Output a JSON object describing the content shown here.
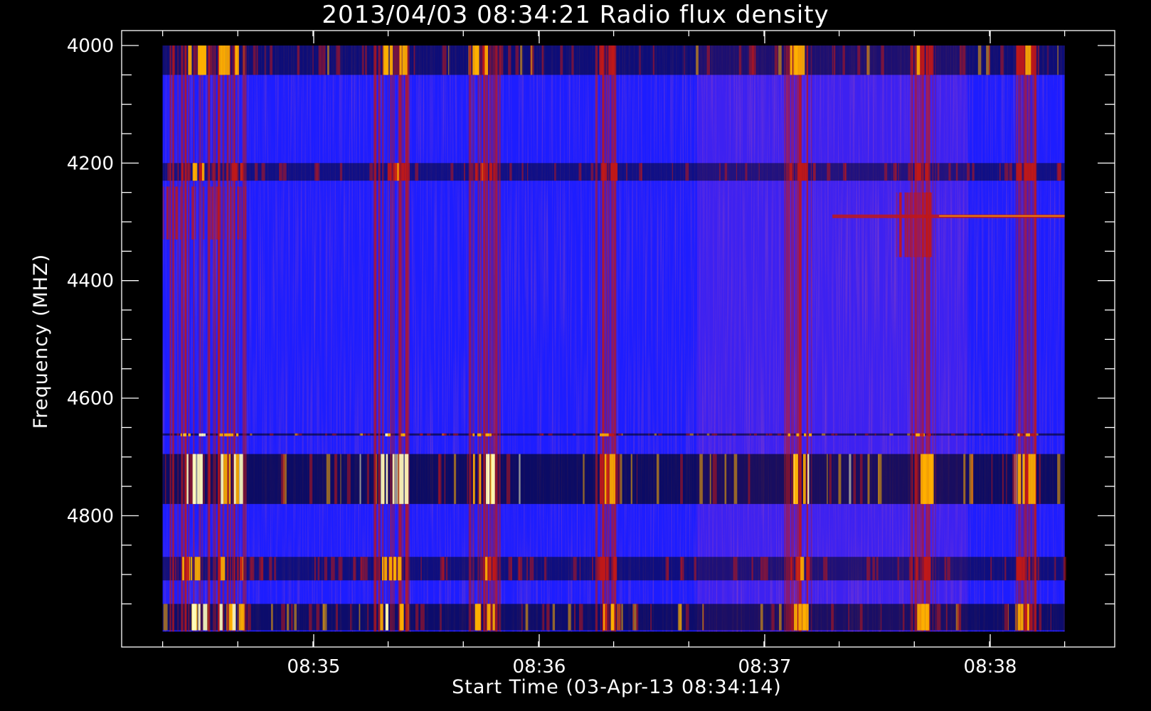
{
  "chart_data": {
    "type": "heatmap",
    "title": "2013/04/03 08:34:21 Radio flux density",
    "xlabel": "Start Time (03-Apr-13 08:34:14)",
    "ylabel": "Frequency (MHZ)",
    "x_ticks": [
      {
        "label": "08:35",
        "value": 35.0
      },
      {
        "label": "08:36",
        "value": 36.0
      },
      {
        "label": "08:37",
        "value": 37.0
      },
      {
        "label": "08:38",
        "value": 38.0
      }
    ],
    "y_ticks": [
      {
        "label": "4000",
        "value": 4000
      },
      {
        "label": "4200",
        "value": 4200
      },
      {
        "label": "4400",
        "value": 4400
      },
      {
        "label": "4600",
        "value": 4600
      },
      {
        "label": "4800",
        "value": 4800
      }
    ],
    "xlim": [
      34.33,
      38.73
    ],
    "ylim": [
      4000,
      5000
    ],
    "data_extent": {
      "x": [
        34.33,
        38.33
      ],
      "y": [
        4000,
        4997
      ]
    },
    "colormap": [
      "#000000",
      "#1d1dff",
      "#7a2bd8",
      "#c01818",
      "#ffb000",
      "#ffffc0"
    ],
    "grid": false,
    "horizontal_bands": [
      {
        "y_range": [
          4000,
          4050
        ],
        "intensity": 0.6
      },
      {
        "y_range": [
          4200,
          4230
        ],
        "intensity": 0.4
      },
      {
        "y_range": [
          4660,
          4660
        ],
        "intensity": 0.7
      },
      {
        "y_range": [
          4695,
          4780
        ],
        "intensity": 0.85
      },
      {
        "y_range": [
          4870,
          4910
        ],
        "intensity": 0.5
      },
      {
        "y_range": [
          4950,
          4995
        ],
        "intensity": 0.75
      }
    ],
    "bursts": [
      {
        "time": 34.45,
        "y_range": [
          4000,
          4995
        ],
        "intensity": 0.95
      },
      {
        "time": 34.63,
        "y_range": [
          4000,
          4995
        ],
        "intensity": 0.85
      },
      {
        "time": 35.35,
        "y_range": [
          4000,
          4995
        ],
        "intensity": 0.9
      },
      {
        "time": 35.75,
        "y_range": [
          4000,
          4995
        ],
        "intensity": 0.8
      },
      {
        "time": 36.3,
        "y_range": [
          4000,
          4995
        ],
        "intensity": 0.55
      },
      {
        "time": 37.15,
        "y_range": [
          4000,
          4995
        ],
        "intensity": 0.75
      },
      {
        "time": 37.7,
        "y_range": [
          4000,
          4995
        ],
        "intensity": 0.6
      },
      {
        "time": 38.15,
        "y_range": [
          4000,
          4995
        ],
        "intensity": 0.55
      }
    ],
    "features": [
      {
        "type": "line",
        "time_range": [
          37.3,
          38.33
        ],
        "frequency": 4290,
        "intensity": 0.75
      },
      {
        "type": "patch",
        "time_range": [
          34.33,
          34.7
        ],
        "y_range": [
          4240,
          4330
        ],
        "intensity": 0.6
      },
      {
        "type": "patch",
        "time_range": [
          37.58,
          37.75
        ],
        "y_range": [
          4250,
          4360
        ],
        "intensity": 0.5
      }
    ]
  }
}
